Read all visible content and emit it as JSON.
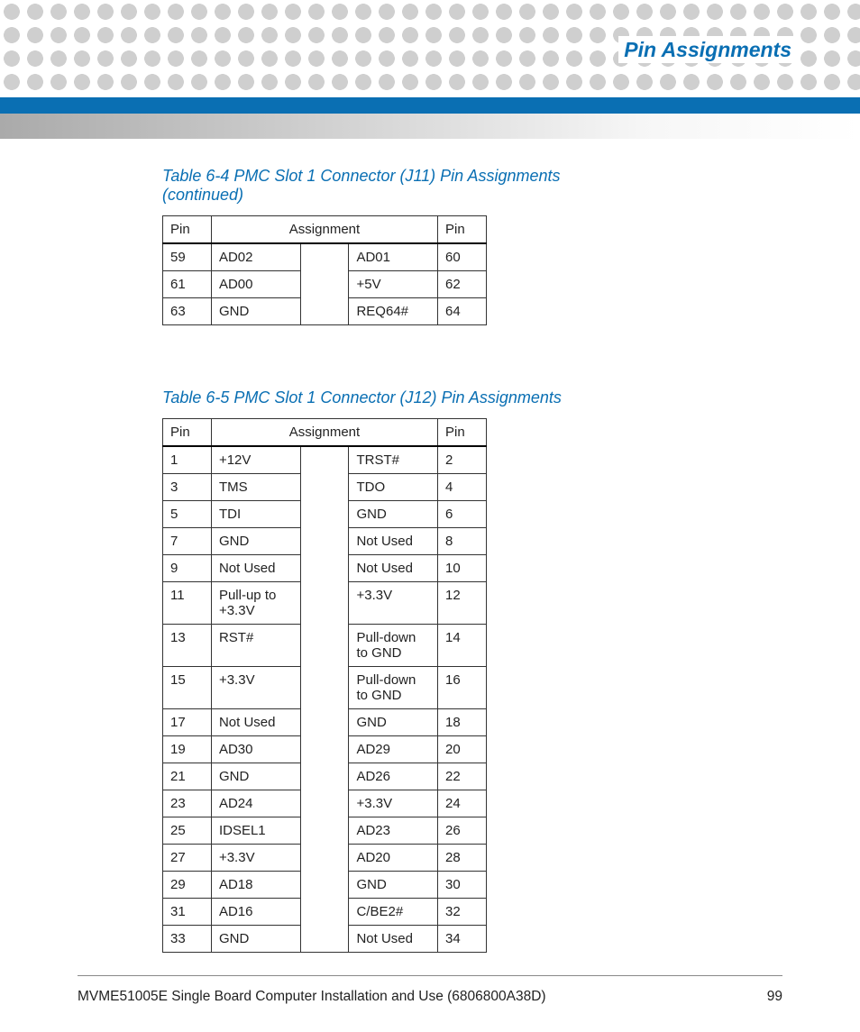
{
  "header": {
    "section_title": "Pin Assignments"
  },
  "tables": [
    {
      "caption": "Table 6-4 PMC Slot 1 Connector (J11) Pin Assignments  (continued)",
      "columns": {
        "pin": "Pin",
        "assignment": "Assignment"
      },
      "rows": [
        {
          "pl": "59",
          "al": "AD02",
          "ar": "AD01",
          "pr": "60"
        },
        {
          "pl": "61",
          "al": "AD00",
          "ar": "+5V",
          "pr": "62"
        },
        {
          "pl": "63",
          "al": "GND",
          "ar": "REQ64#",
          "pr": "64"
        }
      ]
    },
    {
      "caption": "Table 6-5 PMC Slot 1 Connector (J12) Pin Assignments",
      "columns": {
        "pin": "Pin",
        "assignment": "Assignment"
      },
      "rows": [
        {
          "pl": "1",
          "al": "+12V",
          "ar": "TRST#",
          "pr": "2"
        },
        {
          "pl": "3",
          "al": "TMS",
          "ar": "TDO",
          "pr": "4"
        },
        {
          "pl": "5",
          "al": "TDI",
          "ar": "GND",
          "pr": "6"
        },
        {
          "pl": "7",
          "al": "GND",
          "ar": "Not Used",
          "pr": "8"
        },
        {
          "pl": "9",
          "al": "Not Used",
          "ar": "Not Used",
          "pr": "10"
        },
        {
          "pl": "11",
          "al": "Pull-up to +3.3V",
          "ar": "+3.3V",
          "pr": "12"
        },
        {
          "pl": "13",
          "al": "RST#",
          "ar": "Pull-down to GND",
          "pr": "14"
        },
        {
          "pl": "15",
          "al": "+3.3V",
          "ar": "Pull-down to GND",
          "pr": "16"
        },
        {
          "pl": "17",
          "al": "Not Used",
          "ar": "GND",
          "pr": "18"
        },
        {
          "pl": "19",
          "al": "AD30",
          "ar": "AD29",
          "pr": "20"
        },
        {
          "pl": "21",
          "al": "GND",
          "ar": "AD26",
          "pr": "22"
        },
        {
          "pl": "23",
          "al": "AD24",
          "ar": "+3.3V",
          "pr": "24"
        },
        {
          "pl": "25",
          "al": "IDSEL1",
          "ar": "AD23",
          "pr": "26"
        },
        {
          "pl": "27",
          "al": "+3.3V",
          "ar": "AD20",
          "pr": "28"
        },
        {
          "pl": "29",
          "al": "AD18",
          "ar": "GND",
          "pr": "30"
        },
        {
          "pl": "31",
          "al": "AD16",
          "ar": "C/BE2#",
          "pr": "32"
        },
        {
          "pl": "33",
          "al": "GND",
          "ar": "Not Used",
          "pr": "34"
        }
      ]
    }
  ],
  "footer": {
    "doc_title": "MVME51005E Single Board Computer Installation and Use (6806800A38D)",
    "page_number": "99"
  }
}
